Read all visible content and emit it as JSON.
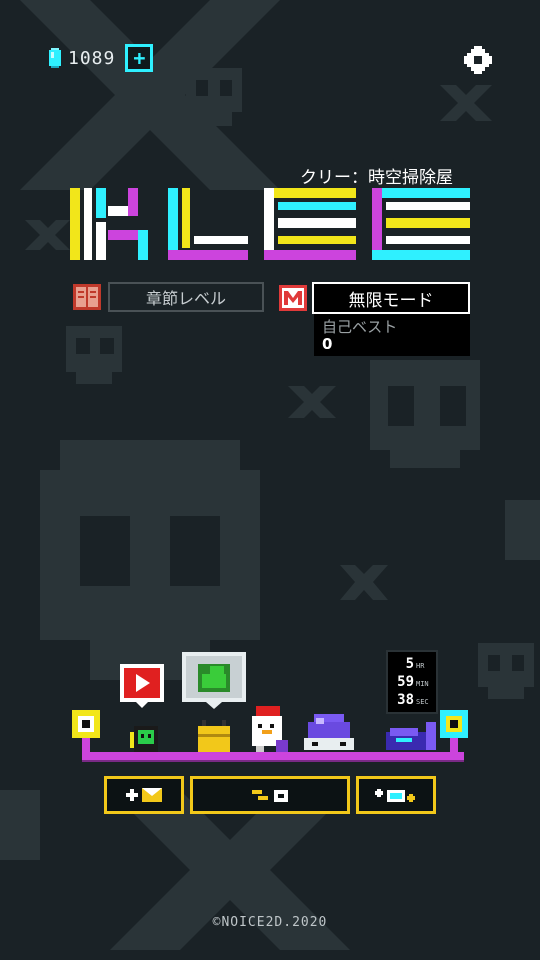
{
  "header": {
    "currency_amount": "1089",
    "currency_icon": "gem-icon",
    "add_currency_icon": "plus-icon",
    "settings_icon": "gear-icon"
  },
  "title": {
    "subtitle": "クリー：時空掃除屋",
    "logo_text": "KLEE"
  },
  "modes": {
    "chapter_label": "章節レベル",
    "endless_label": "無限モード",
    "best_label": "自己ベスト",
    "best_value": "0"
  },
  "timer": {
    "hours": "5",
    "hours_unit": "HR",
    "minutes": "59",
    "minutes_unit": "MIN",
    "seconds": "38",
    "seconds_unit": "SEC"
  },
  "bottom_buttons": {
    "left": "+✉",
    "middle": "⟲ ⊞",
    "right": "+▣+"
  },
  "footer": {
    "copyright": "©NOICE2D.2020"
  },
  "colors": {
    "background": "#1a2226",
    "accent_cyan": "#2ff0ff",
    "accent_yellow": "#f2c81a",
    "accent_magenta": "#cc44dd"
  }
}
